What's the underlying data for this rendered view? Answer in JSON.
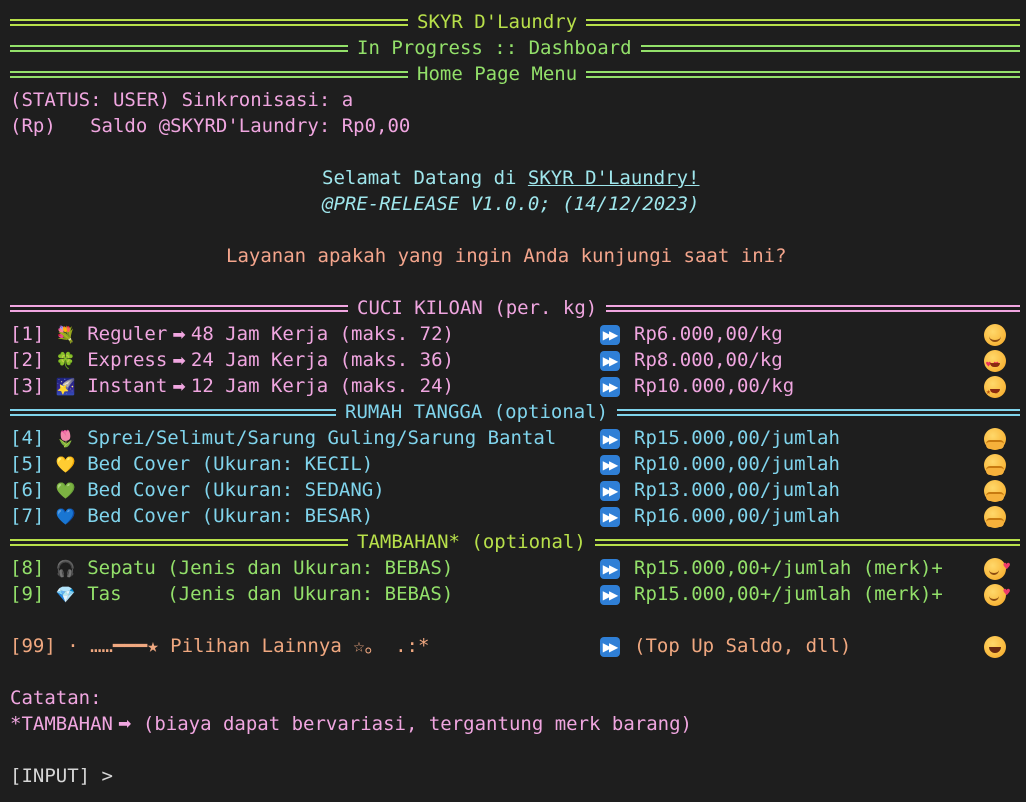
{
  "header": {
    "app_title": "SKYR D'Laundry",
    "subtitle": "In Progress :: Dashboard",
    "page": "Home Page Menu"
  },
  "status": {
    "status_line": "(STATUS: USER) Sinkronisasi: a",
    "saldo_prefix": "(Rp)   Saldo @SKYRD'Laundry: Rp0,00"
  },
  "welcome": {
    "greeting_prefix": "Selamat Datang di ",
    "brand_link": "SKYR D'Laundry!",
    "version": "@PRE-RELEASE V1.0.0; (14/12/2023)",
    "question": "Layanan apakah yang ingin Anda kunjungi saat ini?"
  },
  "sections": {
    "cuci_kiloan": "CUCI KILOAN (per. kg)",
    "rumah_tangga": "RUMAH TANGGA (optional)",
    "tambahan": "TAMBAHAN* (optional)"
  },
  "menu_cuci": [
    {
      "num": "[1]",
      "icon": "flower-icon",
      "glyph": "💐",
      "name": "Reguler",
      "detail": "48 Jam Kerja (maks. 72)",
      "price": "Rp6.000,00/kg",
      "emoji": "smile-emoji"
    },
    {
      "num": "[2]",
      "icon": "clover-icon",
      "glyph": "🍀",
      "name": "Express",
      "detail": "24 Jam Kerja (maks. 36)",
      "price": "Rp8.000,00/kg",
      "emoji": "heart-eyes-emoji"
    },
    {
      "num": "[3]",
      "icon": "night-sky-icon",
      "glyph": "🌠",
      "name": "Instant",
      "detail": "12 Jam Kerja (maks. 24)",
      "price": "Rp10.000,00/kg",
      "emoji": "star-struck-emoji"
    }
  ],
  "menu_rumah": [
    {
      "num": "[4]",
      "icon": "tulip-icon",
      "glyph": "🌷",
      "name": "Sprei/Selimut/Sarung Guling/Sarung Bantal",
      "price": "Rp15.000,00/jumlah",
      "emoji": "hug-emoji"
    },
    {
      "num": "[5]",
      "icon": "yellow-heart-icon",
      "glyph": "💛",
      "name": "Bed Cover (Ukuran: KECIL)",
      "price": "Rp10.000,00/jumlah",
      "emoji": "hug-emoji"
    },
    {
      "num": "[6]",
      "icon": "green-heart-icon",
      "glyph": "💚",
      "name": "Bed Cover (Ukuran: SEDANG)",
      "price": "Rp13.000,00/jumlah",
      "emoji": "hug-emoji"
    },
    {
      "num": "[7]",
      "icon": "blue-heart-icon",
      "glyph": "💙",
      "name": "Bed Cover (Ukuran: BESAR)",
      "price": "Rp16.000,00/jumlah",
      "emoji": "hug-emoji"
    }
  ],
  "menu_tambahan": [
    {
      "num": "[8]",
      "icon": "headphones-icon",
      "glyph": "🎧",
      "name": "Sepatu (Jenis dan Ukuran: BEBAS)",
      "price": "Rp15.000,00+/jumlah (merk)+",
      "emoji": "smiling-hearts-emoji"
    },
    {
      "num": "[9]",
      "icon": "gem-icon",
      "glyph": "💎",
      "name": "Tas    (Jenis dan Ukuran: BEBAS)",
      "price": "Rp15.000,00+/jumlah (merk)+",
      "emoji": "smiling-hearts-emoji"
    }
  ],
  "other_option": {
    "num": "[99]",
    "label": "· ……━━━★ Pilihan Lainnya ☆。 .:*",
    "price": "(Top Up Saldo, dll)",
    "emoji": "grin-emoji"
  },
  "notes": {
    "title": "Catatan:",
    "line_prefix": "*TAMBAHAN",
    "line_text": " (biaya dapat bervariasi, tergantung merk barang)"
  },
  "prompt": {
    "input": "[INPUT] >"
  },
  "colors": {
    "background": "#1e1e1e",
    "banner_green": "#b8e04a",
    "banner_lightgreen": "#93e06a",
    "pink": "#f0a6e0",
    "cyan": "#9fe6ec",
    "salmon": "#f4a58c",
    "ff_blue": "#2f7fd6"
  }
}
